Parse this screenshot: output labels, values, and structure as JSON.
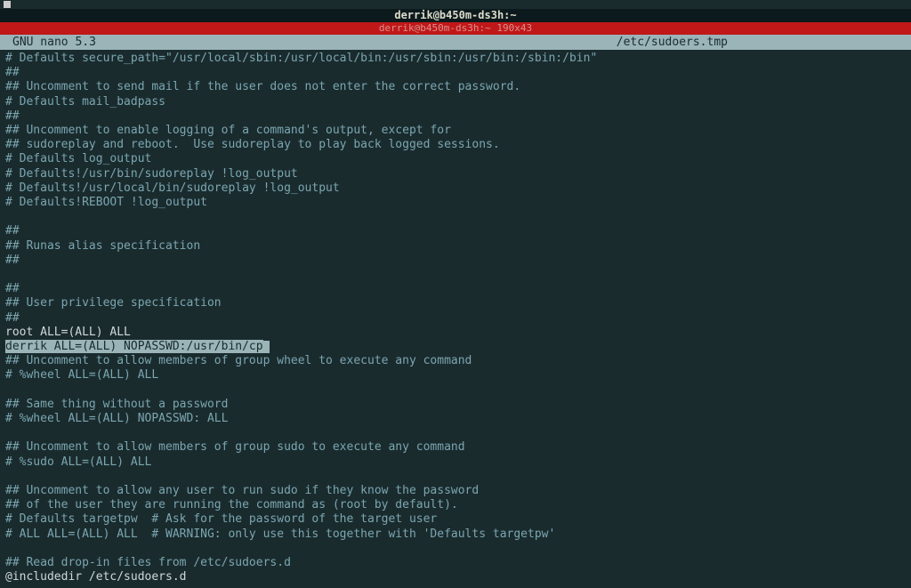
{
  "titlebar": {
    "window_title": "derrik@b450m-ds3h:~",
    "red_bar_text": "derrik@b450m-ds3h:~ 190x43"
  },
  "nano": {
    "app_label": "GNU nano 5.3",
    "file_label": "/etc/sudoers.tmp"
  },
  "lines": [
    "# Defaults secure_path=\"/usr/local/sbin:/usr/local/bin:/usr/sbin:/usr/bin:/sbin:/bin\"",
    "##",
    "## Uncomment to send mail if the user does not enter the correct password.",
    "# Defaults mail_badpass",
    "##",
    "## Uncomment to enable logging of a command's output, except for",
    "## sudoreplay and reboot.  Use sudoreplay to play back logged sessions.",
    "# Defaults log_output",
    "# Defaults!/usr/bin/sudoreplay !log_output",
    "# Defaults!/usr/local/bin/sudoreplay !log_output",
    "# Defaults!REBOOT !log_output",
    "",
    "##",
    "## Runas alias specification",
    "##",
    "",
    "##",
    "## User privilege specification",
    "##",
    "root ALL=(ALL) ALL",
    "derrik ALL=(ALL) NOPASSWD:/usr/bin/cp",
    "## Uncomment to allow members of group wheel to execute any command",
    "# %wheel ALL=(ALL) ALL",
    "",
    "## Same thing without a password",
    "# %wheel ALL=(ALL) NOPASSWD: ALL",
    "",
    "## Uncomment to allow members of group sudo to execute any command",
    "# %sudo ALL=(ALL) ALL",
    "",
    "## Uncomment to allow any user to run sudo if they know the password",
    "## of the user they are running the command as (root by default).",
    "# Defaults targetpw  # Ask for the password of the target user",
    "# ALL ALL=(ALL) ALL  # WARNING: only use this together with 'Defaults targetpw'",
    "",
    "## Read drop-in files from /etc/sudoers.d",
    "@includedir /etc/sudoers.d"
  ],
  "highlight_index": 20,
  "white_indices": [
    19,
    36
  ]
}
